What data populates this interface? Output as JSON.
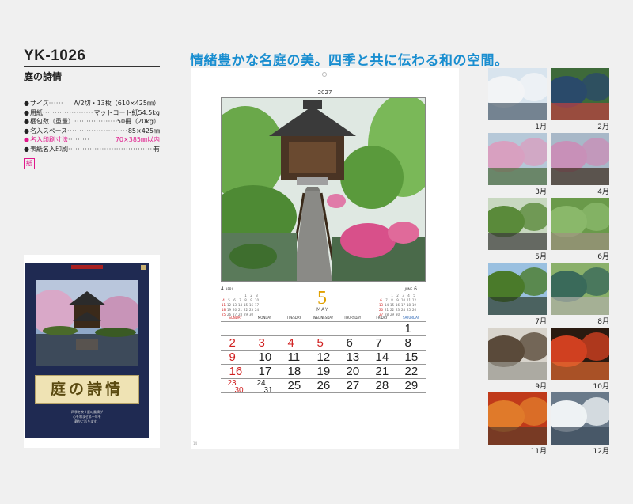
{
  "product": {
    "code": "YK-1026",
    "name": "庭の詩情"
  },
  "specs": [
    {
      "key": "サイズ",
      "dots": "······",
      "value": "A/2切・13枚（610×425㎜）",
      "pink": false
    },
    {
      "key": "用紙",
      "dots": "·······················",
      "value": "マットコート紙54.5kg",
      "pink": false
    },
    {
      "key": "梱包数（重量）",
      "dots": "······················",
      "value": "50冊（20kg）",
      "pink": false
    },
    {
      "key": "名入スペース",
      "dots": "·························",
      "value": "85×425㎜",
      "pink": false
    },
    {
      "key": "名入印刷寸法",
      "dots": "·········",
      "value": "70×385㎜以内",
      "pink": true
    },
    {
      "key": "表紙名入印刷",
      "dots": "······································",
      "value": "有",
      "pink": false
    }
  ],
  "paper_badge": "紙",
  "headline": "情緒豊かな名庭の美。四季と共に伝わる和の空間。",
  "cover": {
    "title": "庭の詩情",
    "text": "四季を映す庭の風情が\n心を和ませる一年を\n静かに彩ります。"
  },
  "calendar": {
    "year": "2027",
    "month_num": "5",
    "month_en": "MAY",
    "prev_month": {
      "num": "4",
      "name": "APRIL"
    },
    "next_month": {
      "num": "6",
      "name": "JUNE"
    },
    "weekdays": [
      "SUNDAY",
      "MONDAY",
      "TUESDAY",
      "WEDNESDAY",
      "THURSDAY",
      "FRIDAY",
      "SATURDAY"
    ],
    "footer": "",
    "page": "14"
  },
  "thumbnails": [
    {
      "label": "1月",
      "scene": "snow"
    },
    {
      "label": "2月",
      "scene": "pond"
    },
    {
      "label": "3月",
      "scene": "blossom"
    },
    {
      "label": "4月",
      "scene": "temple"
    },
    {
      "label": "5月",
      "scene": "temple-green"
    },
    {
      "label": "6月",
      "scene": "moss"
    },
    {
      "label": "7月",
      "scene": "lawn"
    },
    {
      "label": "8月",
      "scene": "stones"
    },
    {
      "label": "9月",
      "scene": "veranda"
    },
    {
      "label": "10月",
      "scene": "red-window"
    },
    {
      "label": "11月",
      "scene": "autumn"
    },
    {
      "label": "12月",
      "scene": "snow-stream"
    }
  ],
  "colors": {
    "headline": "#1a8ed0",
    "accent_pink": "#e0168a",
    "cover_navy": "#1f2a52",
    "month_gold": "#e0a000",
    "holiday_red": "#d02020"
  }
}
